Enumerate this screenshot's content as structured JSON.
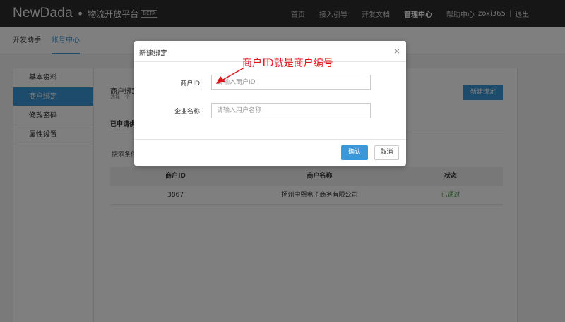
{
  "header": {
    "logo": "NewDada",
    "logo_dot": "•",
    "platform": "物流开放平台",
    "beta_badge": "BETA",
    "nav": [
      {
        "label": "首页"
      },
      {
        "label": "接入引导"
      },
      {
        "label": "开发文档"
      },
      {
        "label": "管理中心"
      },
      {
        "label": "帮助中心"
      }
    ],
    "username": "zoxi365",
    "separator": "|",
    "logout": "退出"
  },
  "subnav": {
    "tabs": [
      {
        "label": "开发助手"
      },
      {
        "label": "账号中心"
      }
    ]
  },
  "sidebar": {
    "items": [
      {
        "label": "基本资料"
      },
      {
        "label": "商户绑定"
      },
      {
        "label": "修改密码"
      },
      {
        "label": "属性设置"
      }
    ]
  },
  "main": {
    "title": "商户绑定",
    "subtitle": "选择一个",
    "new_bind_button": "新建绑定",
    "applied_section": "已申请供",
    "search_label": "搜索条件",
    "table": {
      "headers": [
        "商户ID",
        "商户名称",
        "状态"
      ],
      "rows": [
        {
          "id": "3867",
          "name": "扬州中熙电子商务有限公司",
          "status": "已通过"
        }
      ]
    }
  },
  "modal": {
    "title": "新建绑定",
    "close": "×",
    "merchant_id_label": "商户ID:",
    "merchant_id_placeholder": "请输入商户ID",
    "company_label": "企业名称:",
    "company_placeholder": "请输入用户名称",
    "ok_button": "确认",
    "cancel_button": "取消"
  },
  "annotation": {
    "text": "商户ID就是商户编号",
    "color": "#e0151b"
  },
  "colors": {
    "accent": "#3a97d8",
    "topbar": "#2d2d2d",
    "status_ok": "#3a9a3a"
  }
}
